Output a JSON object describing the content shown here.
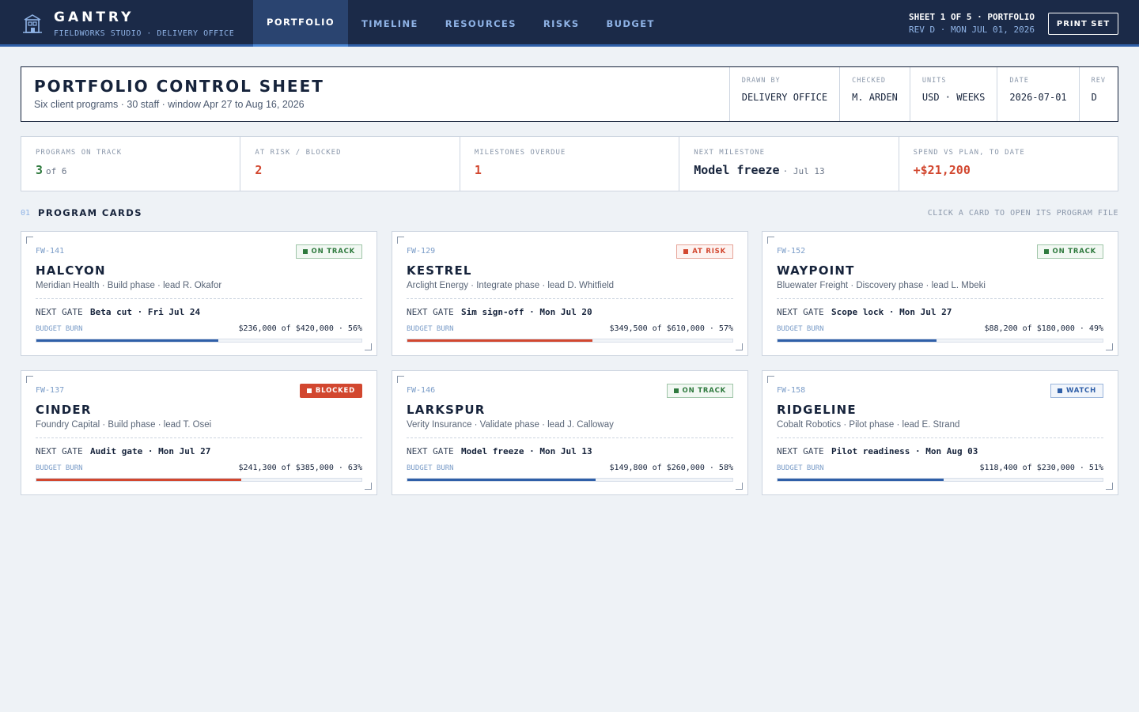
{
  "header": {
    "brand": "GANTRY",
    "brand_sub": "FIELDWORKS STUDIO · DELIVERY OFFICE",
    "nav": [
      "PORTFOLIO",
      "TIMELINE",
      "RESOURCES",
      "RISKS",
      "BUDGET"
    ],
    "active_nav": "PORTFOLIO",
    "sheet_line1": "SHEET 1 OF 5 · PORTFOLIO",
    "sheet_line2": "REV D · MON JUL 01, 2026",
    "print_label": "PRINT SET",
    "logo_icon": "building-icon"
  },
  "titleblock": {
    "title": "PORTFOLIO CONTROL SHEET",
    "subtitle": "Six client programs · 30 staff · window Apr 27 to Aug 16, 2026",
    "drawn_by_label": "DRAWN BY",
    "drawn_by": "DELIVERY OFFICE",
    "checked_label": "CHECKED",
    "checked": "M. ARDEN",
    "units_label": "UNITS",
    "units": "USD · WEEKS",
    "date_label": "DATE",
    "date": "2026-07-01",
    "rev_label": "REV",
    "rev": "D"
  },
  "kpis": {
    "on_track_label": "PROGRAMS ON TRACK",
    "on_track_value": "3",
    "on_track_of": "of 6",
    "at_risk_label": "AT RISK / BLOCKED",
    "at_risk_value": "2",
    "overdue_label": "MILESTONES OVERDUE",
    "overdue_value": "1",
    "next_label": "NEXT MILESTONE",
    "next_value": "Model freeze",
    "next_date": "· Jul 13",
    "spend_label": "SPEND VS PLAN, TO DATE",
    "spend_value": "+$21,200"
  },
  "section": {
    "num": "01",
    "title": "PROGRAM CARDS",
    "hint": "CLICK A CARD TO OPEN ITS PROGRAM FILE"
  },
  "colors": {
    "navy": "#1b2a48",
    "accent_blue": "#2f5fa8",
    "status_green": "#2f7a3e",
    "status_red": "#d2472f"
  },
  "cards": [
    {
      "code": "FW-141",
      "status": "ON TRACK",
      "kind": "on",
      "name": "HALCYON",
      "meta": "Meridian Health · Build phase · lead R. Okafor",
      "gate_label": "NEXT GATE",
      "gate": "Beta cut · Fri Jul 24",
      "burn_label": "BUDGET BURN",
      "burn": "$236,000 of $420,000 · 56%",
      "burn_fraction": 0.56,
      "fill": "blue"
    },
    {
      "code": "FW-129",
      "status": "AT RISK",
      "kind": "risk",
      "name": "KESTREL",
      "meta": "Arclight Energy · Integrate phase · lead D. Whitfield",
      "gate_label": "NEXT GATE",
      "gate": "Sim sign-off · Mon Jul 20",
      "burn_label": "BUDGET BURN",
      "burn": "$349,500 of $610,000 · 57%",
      "burn_fraction": 0.57,
      "fill": "red"
    },
    {
      "code": "FW-152",
      "status": "ON TRACK",
      "kind": "on",
      "name": "WAYPOINT",
      "meta": "Bluewater Freight · Discovery phase · lead L. Mbeki",
      "gate_label": "NEXT GATE",
      "gate": "Scope lock · Mon Jul 27",
      "burn_label": "BUDGET BURN",
      "burn": "$88,200 of $180,000 · 49%",
      "burn_fraction": 0.49,
      "fill": "blue"
    },
    {
      "code": "FW-137",
      "status": "BLOCKED",
      "kind": "blocked",
      "name": "CINDER",
      "meta": "Foundry Capital · Build phase · lead T. Osei",
      "gate_label": "NEXT GATE",
      "gate": "Audit gate · Mon Jul 27",
      "burn_label": "BUDGET BURN",
      "burn": "$241,300 of $385,000 · 63%",
      "burn_fraction": 0.63,
      "fill": "red"
    },
    {
      "code": "FW-146",
      "status": "ON TRACK",
      "kind": "on",
      "name": "LARKSPUR",
      "meta": "Verity Insurance · Validate phase · lead J. Calloway",
      "gate_label": "NEXT GATE",
      "gate": "Model freeze · Mon Jul 13",
      "burn_label": "BUDGET BURN",
      "burn": "$149,800 of $260,000 · 58%",
      "burn_fraction": 0.58,
      "fill": "blue"
    },
    {
      "code": "FW-158",
      "status": "WATCH",
      "kind": "watch",
      "name": "RIDGELINE",
      "meta": "Cobalt Robotics · Pilot phase · lead E. Strand",
      "gate_label": "NEXT GATE",
      "gate": "Pilot readiness · Mon Aug 03",
      "burn_label": "BUDGET BURN",
      "burn": "$118,400 of $230,000 · 51%",
      "burn_fraction": 0.51,
      "fill": "blue"
    }
  ]
}
